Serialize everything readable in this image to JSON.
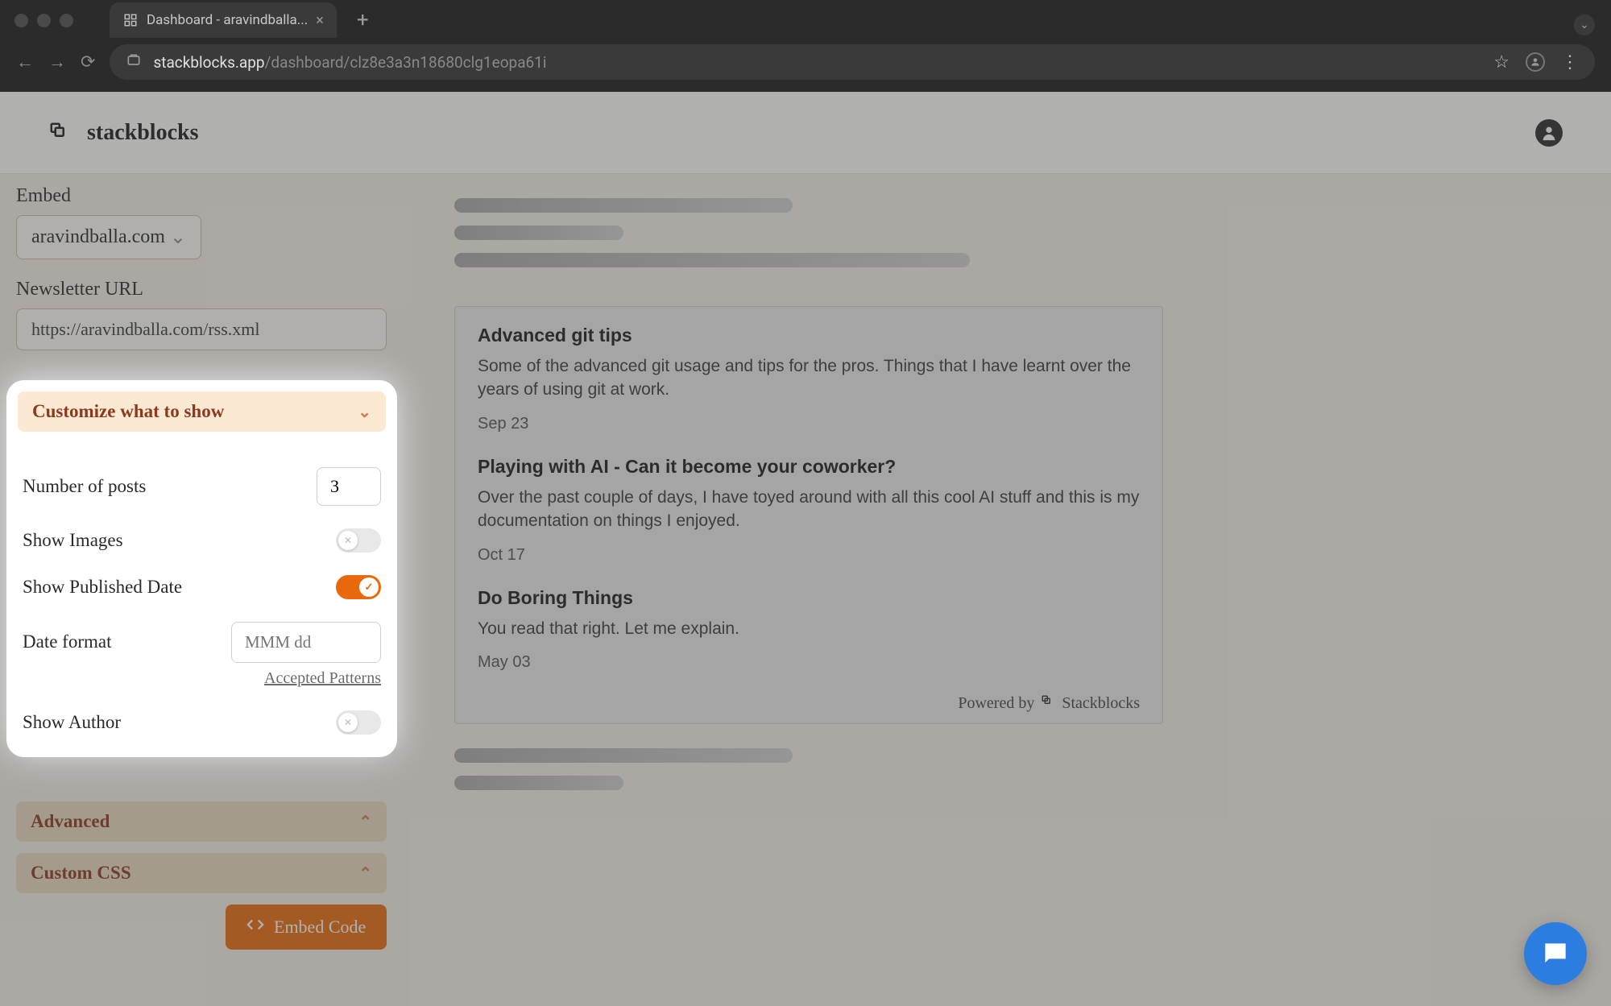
{
  "browser": {
    "tab_title": "Dashboard - aravindballa...",
    "url_domain": "stackblocks.app",
    "url_path": "/dashboard/clz8e3a3n18680clg1eopa61i"
  },
  "header": {
    "brand": "stackblocks"
  },
  "sidebar": {
    "embed_label": "Embed",
    "embed_select_value": "aravindballa.com",
    "newsletter_label": "Newsletter URL",
    "newsletter_value": "https://aravindballa.com/rss.xml",
    "customize": {
      "title": "Customize what to show",
      "num_posts_label": "Number of posts",
      "num_posts_value": "3",
      "show_images_label": "Show Images",
      "show_published_label": "Show Published Date",
      "date_format_label": "Date format",
      "date_format_placeholder": "MMM dd",
      "accepted_patterns": "Accepted Patterns",
      "show_author_label": "Show Author"
    },
    "advanced_label": "Advanced",
    "custom_css_label": "Custom CSS",
    "embed_button": "Embed Code"
  },
  "preview": {
    "posts": [
      {
        "title": "Advanced git tips",
        "desc": "Some of the advanced git usage and tips for the pros. Things that I have learnt over the years of using git at work.",
        "date": "Sep 23"
      },
      {
        "title": "Playing with AI - Can it become your coworker?",
        "desc": "Over the past couple of days, I have toyed around with all this cool AI stuff and this is my documentation on things I enjoyed.",
        "date": "Oct 17"
      },
      {
        "title": "Do Boring Things",
        "desc": "You read that right. Let me explain.",
        "date": "May 03"
      }
    ],
    "powered_by_prefix": "Powered by",
    "powered_by_brand": "Stackblocks"
  }
}
